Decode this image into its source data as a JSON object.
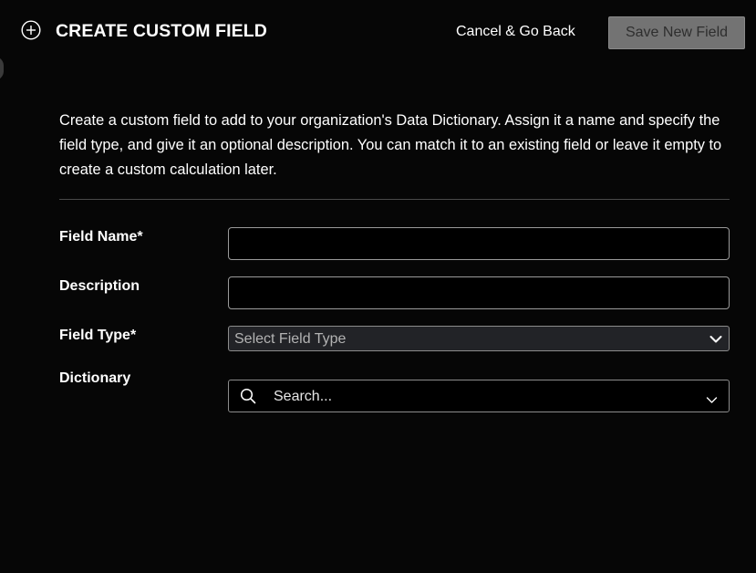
{
  "header": {
    "icon": "plus-circle-icon",
    "title": "CREATE CUSTOM FIELD",
    "cancel_label": "Cancel & Go Back",
    "save_label": "Save New Field"
  },
  "intro": {
    "text": "Create a custom field to add to your organization's Data Dictionary. Assign it a name and specify the field type, and give it an optional description. You can match it to an existing field or leave it empty to create a custom calculation later."
  },
  "form": {
    "field_name": {
      "label": "Field Name*",
      "value": "",
      "placeholder": ""
    },
    "description": {
      "label": "Description",
      "value": "",
      "placeholder": ""
    },
    "field_type": {
      "label": "Field Type*",
      "placeholder": "Select Field Type",
      "icon": "chevron-down-icon"
    },
    "dictionary": {
      "label": "Dictionary",
      "placeholder": "Search...",
      "search_icon": "search-icon",
      "chevron_icon": "chevron-down-icon"
    }
  },
  "colors": {
    "background": "#060606",
    "text": "#ffffff",
    "disabled_button_bg": "#737373",
    "disabled_button_text": "#2e2e2e",
    "input_border": "#9a9a9a",
    "select_bg": "#222327"
  }
}
